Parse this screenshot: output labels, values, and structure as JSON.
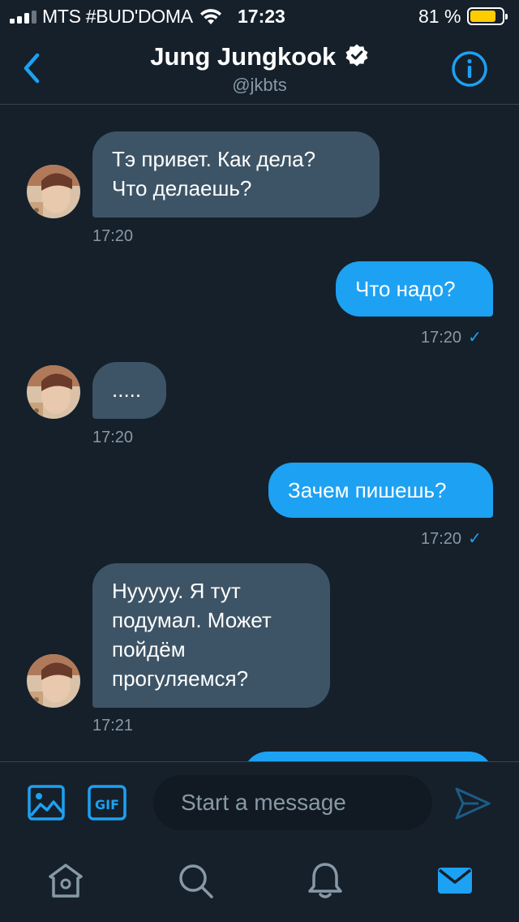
{
  "status_bar": {
    "carrier": "MTS #BUD'DOMA",
    "time": "17:23",
    "battery_percent": "81 %",
    "battery_level": 0.81,
    "battery_color": "#ffcc00"
  },
  "header": {
    "title": "Jung Jungkook",
    "handle": "@jkbts",
    "verified_icon": "verified-badge-icon",
    "back_icon": "chevron-left-icon",
    "info_icon": "info-icon"
  },
  "messages": [
    {
      "direction": "in",
      "text_lines": [
        "Тэ привет. Как дела?",
        "Что делаешь?"
      ],
      "time": "17:20"
    },
    {
      "direction": "out",
      "text_lines": [
        "Что надо?"
      ],
      "time": "17:20",
      "read_check": "✓"
    },
    {
      "direction": "in",
      "text_lines": [
        "....."
      ],
      "time": "17:20"
    },
    {
      "direction": "out",
      "text_lines": [
        "Зачем пишешь?"
      ],
      "time": "17:20",
      "read_check": "✓"
    },
    {
      "direction": "in",
      "text_lines": [
        "Нууууу. Я тут",
        "подумал. Может",
        "пойдём",
        "прогуляемся?"
      ],
      "time": "17:21"
    }
  ],
  "composer": {
    "placeholder": "Start a message",
    "media_icon": "image-icon",
    "gif_label": "GIF",
    "send_icon": "send-icon"
  },
  "tabbar": {
    "items": [
      "home-icon",
      "search-icon",
      "notifications-icon",
      "messages-icon"
    ],
    "active": "messages-icon"
  },
  "colors": {
    "background": "#15202b",
    "accent": "#1da1f2",
    "incoming_bubble": "#3d5466",
    "secondary_text": "#8899a6"
  }
}
